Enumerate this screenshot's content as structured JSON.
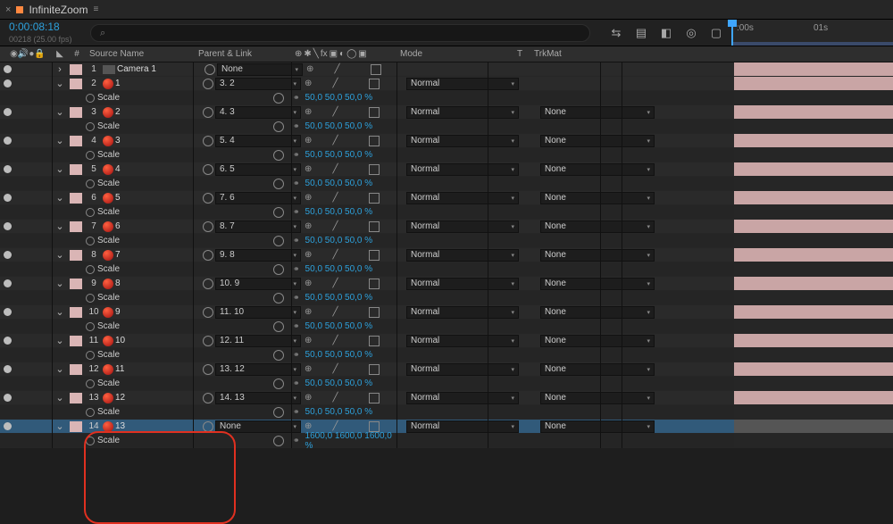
{
  "panel": {
    "title": "InfiniteZoom",
    "timecode": "0:00:08:18",
    "framesub": "00218 (25.00 fps)",
    "search_placeholder": "⌕"
  },
  "ruler": {
    "t0": ":00s",
    "t1": "01s"
  },
  "cols": {
    "num": "#",
    "source": "Source Name",
    "parent": "Parent & Link",
    "mode": "Mode",
    "t": "T",
    "trk": "TrkMat"
  },
  "misc": {
    "scale_label": "Scale",
    "none": "None",
    "normal": "Normal"
  },
  "layers": [
    {
      "idx": 1,
      "name": "Camera 1",
      "icon": "video",
      "parent": "None",
      "hasScale": false,
      "mode": "",
      "trk": "",
      "sel": false,
      "open": false,
      "bar": "bar-pink"
    },
    {
      "idx": 2,
      "name": "1",
      "icon": "red",
      "parent": "3. 2",
      "hasScale": true,
      "scale": "50,0 50,0 50,0 %",
      "mode": "Normal",
      "trk": "",
      "sel": false,
      "open": true,
      "bar": "bar-pink"
    },
    {
      "idx": 3,
      "name": "2",
      "icon": "red",
      "parent": "4. 3",
      "hasScale": true,
      "scale": "50,0 50,0 50,0 %",
      "mode": "Normal",
      "trk": "None",
      "sel": false,
      "open": true,
      "bar": "bar-pink"
    },
    {
      "idx": 4,
      "name": "3",
      "icon": "red",
      "parent": "5. 4",
      "hasScale": true,
      "scale": "50,0 50,0 50,0 %",
      "mode": "Normal",
      "trk": "None",
      "sel": false,
      "open": true,
      "bar": "bar-pink"
    },
    {
      "idx": 5,
      "name": "4",
      "icon": "red",
      "parent": "6. 5",
      "hasScale": true,
      "scale": "50,0 50,0 50,0 %",
      "mode": "Normal",
      "trk": "None",
      "sel": false,
      "open": true,
      "bar": "bar-pink"
    },
    {
      "idx": 6,
      "name": "5",
      "icon": "red",
      "parent": "7. 6",
      "hasScale": true,
      "scale": "50,0 50,0 50,0 %",
      "mode": "Normal",
      "trk": "None",
      "sel": false,
      "open": true,
      "bar": "bar-pink"
    },
    {
      "idx": 7,
      "name": "6",
      "icon": "red",
      "parent": "8. 7",
      "hasScale": true,
      "scale": "50,0 50,0 50,0 %",
      "mode": "Normal",
      "trk": "None",
      "sel": false,
      "open": true,
      "bar": "bar-pink"
    },
    {
      "idx": 8,
      "name": "7",
      "icon": "red",
      "parent": "9. 8",
      "hasScale": true,
      "scale": "50,0 50,0 50,0 %",
      "mode": "Normal",
      "trk": "None",
      "sel": false,
      "open": true,
      "bar": "bar-pink"
    },
    {
      "idx": 9,
      "name": "8",
      "icon": "red",
      "parent": "10. 9",
      "hasScale": true,
      "scale": "50,0 50,0 50,0 %",
      "mode": "Normal",
      "trk": "None",
      "sel": false,
      "open": true,
      "bar": "bar-pink"
    },
    {
      "idx": 10,
      "name": "9",
      "icon": "red",
      "parent": "11. 10",
      "hasScale": true,
      "scale": "50,0 50,0 50,0 %",
      "mode": "Normal",
      "trk": "None",
      "sel": false,
      "open": true,
      "bar": "bar-pink"
    },
    {
      "idx": 11,
      "name": "10",
      "icon": "red",
      "parent": "12. 11",
      "hasScale": true,
      "scale": "50,0 50,0 50,0 %",
      "mode": "Normal",
      "trk": "None",
      "sel": false,
      "open": true,
      "bar": "bar-pink"
    },
    {
      "idx": 12,
      "name": "11",
      "icon": "red",
      "parent": "13. 12",
      "hasScale": true,
      "scale": "50,0 50,0 50,0 %",
      "mode": "Normal",
      "trk": "None",
      "sel": false,
      "open": true,
      "bar": "bar-pink"
    },
    {
      "idx": 13,
      "name": "12",
      "icon": "red",
      "parent": "14. 13",
      "hasScale": true,
      "scale": "50,0 50,0 50,0 %",
      "mode": "Normal",
      "trk": "None",
      "sel": false,
      "open": true,
      "bar": "bar-pink"
    },
    {
      "idx": 14,
      "name": "13",
      "icon": "red",
      "parent": "None",
      "hasScale": true,
      "scale": "1600,0 1600,0 1600,0 %",
      "mode": "Normal",
      "trk": "None",
      "sel": true,
      "open": true,
      "bar": "bar-grey"
    }
  ]
}
